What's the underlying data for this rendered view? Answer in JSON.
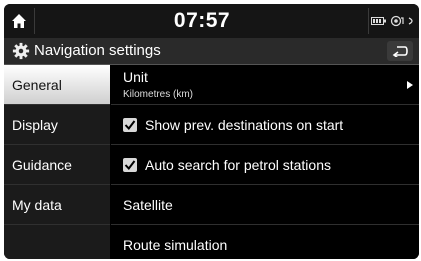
{
  "status_bar": {
    "time": "07:57",
    "icons": [
      "battery-icon",
      "gps-signal-icon",
      "wifi-icon"
    ]
  },
  "header": {
    "title": "Navigation settings"
  },
  "tabs": [
    {
      "label": "General",
      "active": true
    },
    {
      "label": "Display",
      "active": false
    },
    {
      "label": "Guidance",
      "active": false
    },
    {
      "label": "My data",
      "active": false
    }
  ],
  "settings": {
    "unit": {
      "label": "Unit",
      "value": "Kilometres (km)"
    },
    "show_prev": {
      "label": "Show prev. destinations on start",
      "checked": true
    },
    "auto_search": {
      "label": "Auto search for petrol stations",
      "checked": true
    },
    "satellite": {
      "label": "Satellite"
    },
    "route_sim": {
      "label": "Route simulation"
    }
  },
  "colors": {
    "active_tab": "#ffffff",
    "background": "#000000",
    "sidebar": "#1b1b1b"
  }
}
